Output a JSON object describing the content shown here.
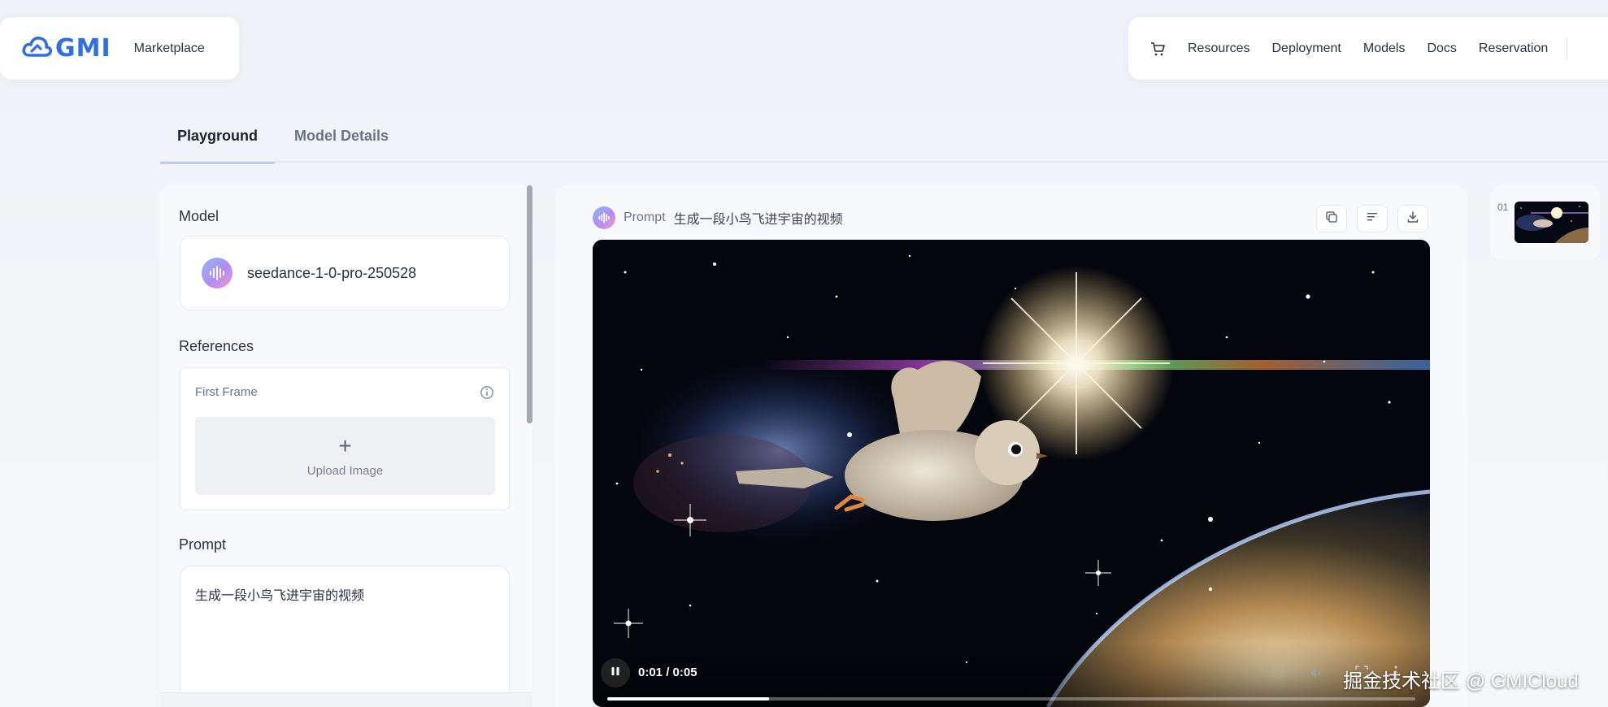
{
  "brand": {
    "logo_text": "GMI",
    "section": "Marketplace",
    "logo_icon": "cloud-logo-icon",
    "accent_color": "#2f6fe0"
  },
  "top_nav": {
    "cart_icon": "cart-icon",
    "items": [
      "Resources",
      "Deployment",
      "Models",
      "Docs",
      "Reservation"
    ]
  },
  "tabs": {
    "playground": "Playground",
    "model_details": "Model Details"
  },
  "left_panel": {
    "model_label": "Model",
    "model_name": "seedance-1-0-pro-250528",
    "references_label": "References",
    "first_frame_label": "First Frame",
    "upload_label": "Upload Image",
    "prompt_label": "Prompt",
    "prompt_value": "生成一段小鸟飞进宇宙的视频"
  },
  "result": {
    "prompt_tag": "Prompt",
    "prompt_text": "生成一段小鸟飞进宇宙的视频",
    "tools": [
      "copy-icon",
      "text-align-icon",
      "download-icon"
    ]
  },
  "video": {
    "time": "0:01 / 0:05",
    "progress": 0.2
  },
  "history": {
    "thumb_index": "01"
  },
  "watermark": "掘金技术社区 @ GMICloud"
}
